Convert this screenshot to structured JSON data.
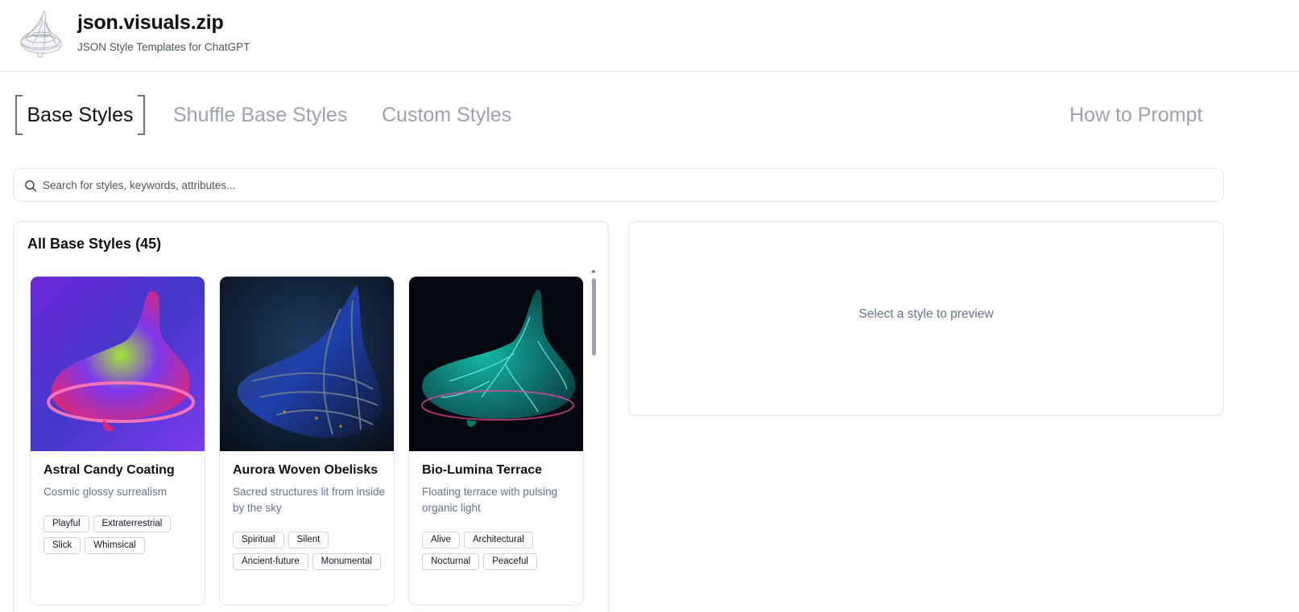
{
  "header": {
    "title": "json.visuals.zip",
    "subtitle": "JSON Style Templates for ChatGPT",
    "logo_icon": "spinning-top-wireframe-icon"
  },
  "tabs": [
    {
      "label": "Base Styles",
      "active": true
    },
    {
      "label": "Shuffle Base Styles",
      "active": false
    },
    {
      "label": "Custom Styles",
      "active": false
    },
    {
      "label": "How to Prompt",
      "active": false
    }
  ],
  "search": {
    "placeholder": "Search for styles, keywords, attributes...",
    "value": "",
    "icon": "search-icon"
  },
  "styles_panel": {
    "heading": "All Base Styles (45)",
    "cards": [
      {
        "title": "Astral Candy Coating",
        "description": "Cosmic glossy surrealism",
        "tags": [
          "Playful",
          "Extraterrestrial",
          "Slick",
          "Whimsical"
        ],
        "palette": {
          "bg": "#4c2ea8",
          "top": "#e0249a",
          "accent": "#79d13a"
        }
      },
      {
        "title": "Aurora Woven Obelisks",
        "description": "Sacred structures lit from inside by the sky",
        "tags": [
          "Spiritual",
          "Silent",
          "Ancient-future",
          "Monumental"
        ],
        "palette": {
          "bg": "#0f1b2e",
          "top": "#1e3a8a",
          "accent": "#d4a017"
        }
      },
      {
        "title": "Bio-Lumina Terrace",
        "description": "Floating terrace with pulsing organic light",
        "tags": [
          "Alive",
          "Architectural",
          "Nocturnal",
          "Peaceful"
        ],
        "palette": {
          "bg": "#060d14",
          "top": "#0f7c7a",
          "accent": "#5ef2e6"
        }
      }
    ]
  },
  "preview": {
    "empty_text": "Select a style to preview"
  }
}
